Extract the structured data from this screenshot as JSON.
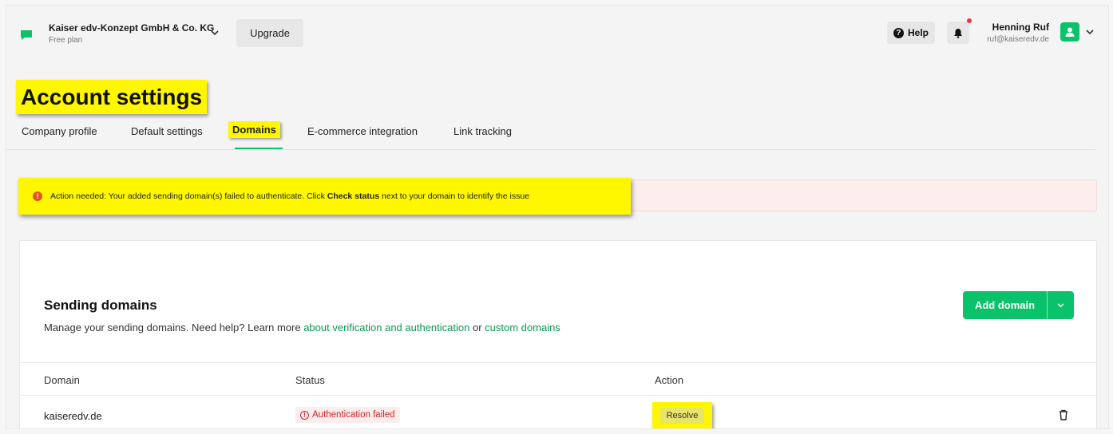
{
  "header": {
    "org_name": "Kaiser edv-Konzept GmbH & Co. KG",
    "org_plan": "Free plan",
    "upgrade_label": "Upgrade",
    "help_label": "Help",
    "user_name": "Henning Ruf",
    "user_email": "ruf@kaiseredv.de",
    "accent_color": "#09c269"
  },
  "page": {
    "title": "Account settings"
  },
  "tabs": [
    {
      "label": "Company profile"
    },
    {
      "label": "Default settings"
    },
    {
      "label": "Domains",
      "active": true
    },
    {
      "label": "E-commerce integration"
    },
    {
      "label": "Link tracking"
    }
  ],
  "alert": {
    "text_before": "Action needed: Your added sending domain(s) failed to authenticate. Click ",
    "text_bold": "Check status",
    "text_after": " next to your domain to identify the issue"
  },
  "card": {
    "title": "Sending domains",
    "desc_prefix": "Manage your sending domains. Need help? Learn more ",
    "link1": "about verification and authentication",
    "desc_mid": " or ",
    "link2": "custom domains",
    "add_button_label": "Add domain"
  },
  "table": {
    "columns": [
      "Domain",
      "Status",
      "Action"
    ],
    "rows": [
      {
        "domain": "kaiseredv.de",
        "status": "Authentication failed",
        "action": "Resolve"
      }
    ]
  }
}
